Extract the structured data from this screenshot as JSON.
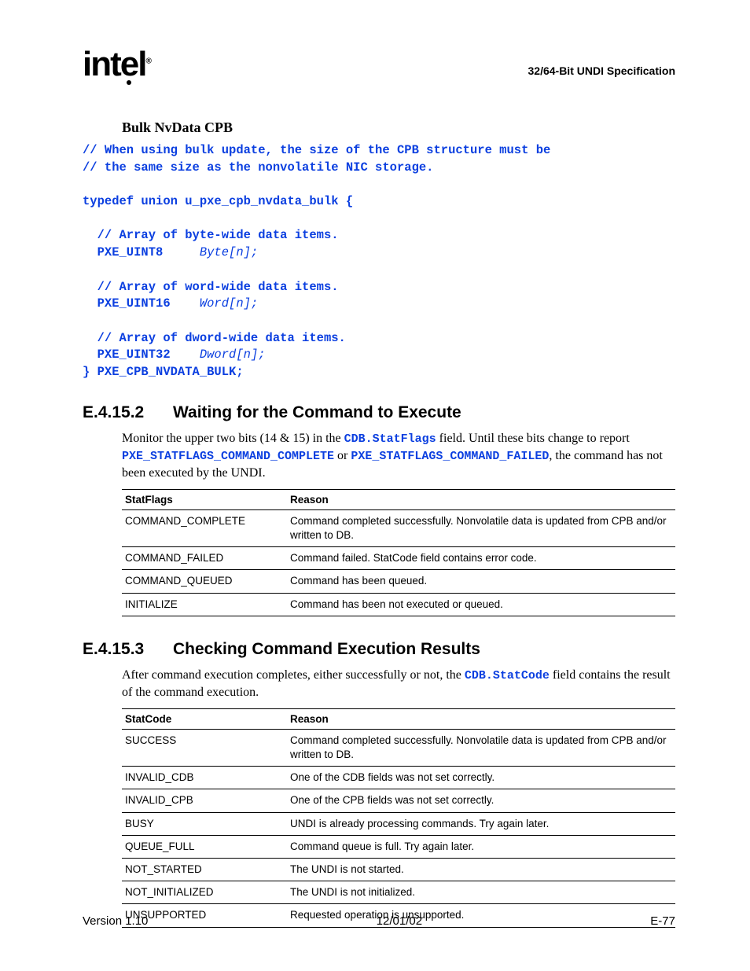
{
  "header": {
    "logo": "intel",
    "spec": "32/64-Bit UNDI Specification"
  },
  "subheading1": "Bulk NvData CPB",
  "code": {
    "c1": "// When using bulk update, the size of the CPB structure must be",
    "c2": "// the same size as the nonvolatile NIC storage.",
    "c3": "typedef union u_pxe_cpb_nvdata_bulk {",
    "c4": "  // Array of byte-wide data items.",
    "c5a": "  PXE_UINT8     ",
    "c5b": "Byte[n];",
    "c6": "  // Array of word-wide data items.",
    "c7a": "  PXE_UINT16    ",
    "c7b": "Word[n];",
    "c8": "  // Array of dword-wide data items.",
    "c9a": "  PXE_UINT32    ",
    "c9b": "Dword[n];",
    "c10": "} PXE_CPB_NVDATA_BULK;"
  },
  "section1": {
    "num": "E.4.15.2",
    "title": "Waiting for the Command to Execute",
    "para_a": "Monitor the upper two bits (14 & 15) in the ",
    "para_code1": "CDB.StatFlags",
    "para_b": " field.  Until these bits change to report ",
    "para_code2": "PXE_STATFLAGS_COMMAND_COMPLETE",
    "para_c": " or ",
    "para_code3": "PXE_STATFLAGS_COMMAND_FAILED",
    "para_d": ", the command has not been executed by the UNDI."
  },
  "table1": {
    "h1": "StatFlags",
    "h2": "Reason",
    "rows": [
      {
        "c1": "COMMAND_COMPLETE",
        "c2": "Command completed successfully.  Nonvolatile data is updated from CPB and/or written to DB."
      },
      {
        "c1": "COMMAND_FAILED",
        "c2": "Command failed.  StatCode field contains error code."
      },
      {
        "c1": "COMMAND_QUEUED",
        "c2": "Command has been queued."
      },
      {
        "c1": "INITIALIZE",
        "c2": "Command has been not executed or queued."
      }
    ]
  },
  "section2": {
    "num": "E.4.15.3",
    "title": "Checking Command Execution Results",
    "para_a": "After command execution completes, either successfully or not, the ",
    "para_code1": "CDB.StatCode",
    "para_b": " field contains the result of the command execution."
  },
  "table2": {
    "h1": "StatCode",
    "h2": "Reason",
    "rows": [
      {
        "c1": "SUCCESS",
        "c2": "Command completed successfully.  Nonvolatile data is updated from CPB and/or written to DB."
      },
      {
        "c1": "INVALID_CDB",
        "c2": "One of the CDB fields was not set correctly."
      },
      {
        "c1": "INVALID_CPB",
        "c2": "One of the CPB fields was not set correctly."
      },
      {
        "c1": "BUSY",
        "c2": "UNDI is already processing commands.  Try again later."
      },
      {
        "c1": "QUEUE_FULL",
        "c2": "Command queue is full.  Try again later."
      },
      {
        "c1": "NOT_STARTED",
        "c2": "The UNDI is not started."
      },
      {
        "c1": "NOT_INITIALIZED",
        "c2": "The UNDI is not initialized."
      },
      {
        "c1": "UNSUPPORTED",
        "c2": "Requested operation is unsupported."
      }
    ]
  },
  "footer": {
    "left": "Version 1.10",
    "center": "12/01/02",
    "right": "E-77"
  }
}
